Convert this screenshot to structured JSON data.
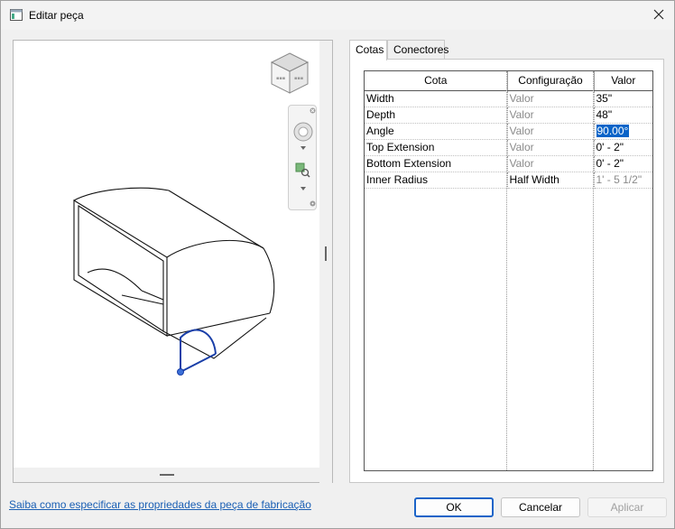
{
  "window": {
    "title": "Editar peça"
  },
  "tabs": [
    {
      "label": "Cotas",
      "active": true
    },
    {
      "label": "Conectores",
      "active": false
    }
  ],
  "grid": {
    "headers": [
      "Cota",
      "Configuração",
      "Valor"
    ],
    "rows": [
      {
        "name": "Width",
        "config": "Valor",
        "value": "35\"",
        "config_muted": true,
        "value_muted": false,
        "selected": false
      },
      {
        "name": "Depth",
        "config": "Valor",
        "value": "48\"",
        "config_muted": true,
        "value_muted": false,
        "selected": false
      },
      {
        "name": "Angle",
        "config": "Valor",
        "value": "90.00°",
        "config_muted": true,
        "value_muted": false,
        "selected": true
      },
      {
        "name": "Top Extension",
        "config": "Valor",
        "value": "0' - 2\"",
        "config_muted": true,
        "value_muted": false,
        "selected": false
      },
      {
        "name": "Bottom Extension",
        "config": "Valor",
        "value": "0' - 2\"",
        "config_muted": true,
        "value_muted": false,
        "selected": false
      },
      {
        "name": "Inner Radius",
        "config": "Half Width",
        "value": "1' - 5 1/2\"",
        "config_muted": false,
        "value_muted": true,
        "selected": false
      }
    ]
  },
  "footer": {
    "help_link": "Saiba como especificar as propriedades da peça de fabricação",
    "ok": "OK",
    "cancel": "Cancelar",
    "apply": "Aplicar"
  },
  "icons": {
    "app": "window-icon",
    "close": "close-icon",
    "viewcube": "viewcube-icon",
    "steering_wheel": "steering-wheel-icon",
    "zoom": "zoom-icon"
  },
  "colors": {
    "selection": "#0a64c8",
    "connector": "#1a3fa8",
    "link": "#1a5fb4",
    "ok_border": "#1b64c8"
  }
}
